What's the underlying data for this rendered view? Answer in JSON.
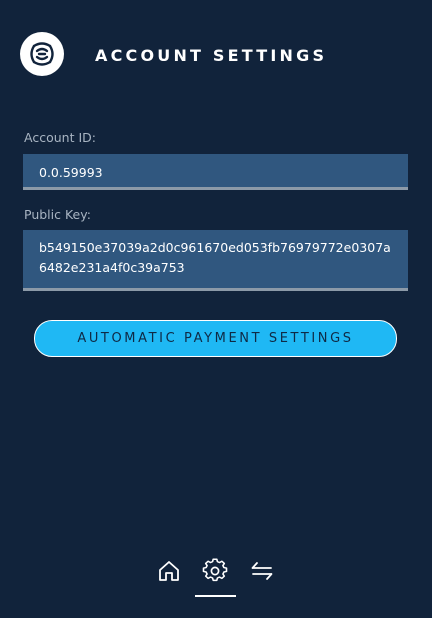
{
  "header": {
    "logo_icon": "hbar-swirl-logo-icon",
    "title": "ACCOUNT SETTINGS"
  },
  "fields": {
    "account_id": {
      "label": "Account ID:",
      "value": "0.0.59993"
    },
    "public_key": {
      "label": "Public Key:",
      "value": "b549150e37039a2d0c961670ed053fb76979772e0307a6482e231a4f0c39a753"
    }
  },
  "actions": {
    "automatic_payment_label": "AUTOMATIC PAYMENT SETTINGS"
  },
  "nav": {
    "items": [
      {
        "icon": "home-icon",
        "active": false
      },
      {
        "icon": "gear-icon",
        "active": true
      },
      {
        "icon": "transfer-arrows-icon",
        "active": false
      }
    ]
  },
  "colors": {
    "background": "#11233b",
    "field_background": "#30577f",
    "accent": "#1fb8f4",
    "label_text": "#a8b4c2"
  }
}
